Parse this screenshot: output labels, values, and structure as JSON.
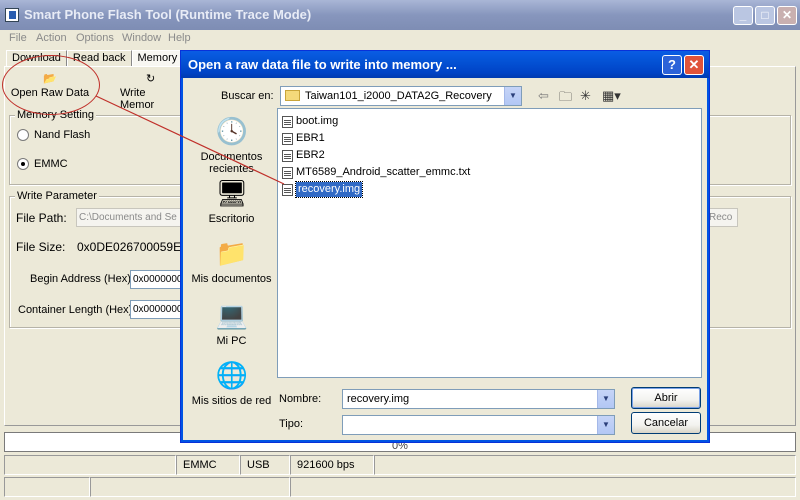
{
  "app": {
    "title": "Smart Phone Flash Tool (Runtime Trace Mode)",
    "window_buttons": {
      "minimize": "_",
      "maximize": "□",
      "close": "✕"
    }
  },
  "menu": [
    "File",
    "Action",
    "Options",
    "Window",
    "Help"
  ],
  "tabs": [
    "Download",
    "Read back",
    "Memory Te"
  ],
  "toolbar": {
    "open_raw_data": "Open Raw Data",
    "write_memory": "Write Memor"
  },
  "memory_setting": {
    "label": "Memory Setting",
    "nand_flash": "Nand Flash",
    "emmc": "EMMC",
    "selected": "EMMC"
  },
  "write_parameter": {
    "label": "Write Parameter",
    "file_path_label": "File Path:",
    "file_path_value": "C:\\Documents and Se",
    "file_path_tail": "Reco",
    "file_size_label": "File Size:",
    "file_size_value": "0x0DE026700059E",
    "begin_address_label": "Begin Address (Hex) :",
    "begin_address_value": "0x0000000",
    "container_length_label": "Container Length (Hex) :",
    "container_length_value": "0x0000000"
  },
  "progress": {
    "text": "0%"
  },
  "status_bar": {
    "storage": "EMMC",
    "port": "USB",
    "baud": "921600 bps"
  },
  "dialog": {
    "title": "Open a raw data file to write into memory ...",
    "help_button": "?",
    "close_button": "✕",
    "look_in_label": "Buscar en:",
    "look_in_value": "Taiwan101_i2000_DATA2G_Recovery",
    "places": [
      {
        "label": "Documentos recientes",
        "icon": "recent-documents-icon"
      },
      {
        "label": "Escritorio",
        "icon": "desktop-icon"
      },
      {
        "label": "Mis documentos",
        "icon": "my-documents-icon"
      },
      {
        "label": "Mi PC",
        "icon": "my-computer-icon"
      },
      {
        "label": "Mis sitios de red",
        "icon": "network-places-icon"
      }
    ],
    "files": [
      "boot.img",
      "EBR1",
      "EBR2",
      "MT6589_Android_scatter_emmc.txt",
      "recovery.img"
    ],
    "selected_file": "recovery.img",
    "filename_label": "Nombre:",
    "filename_value": "recovery.img",
    "filetype_label": "Tipo:",
    "filetype_value": "",
    "open_button": "Abrir",
    "cancel_button": "Cancelar"
  },
  "colors": {
    "dialog_title": "#0054e3",
    "selection": "#316ac5",
    "annotation": "#c0302a"
  }
}
